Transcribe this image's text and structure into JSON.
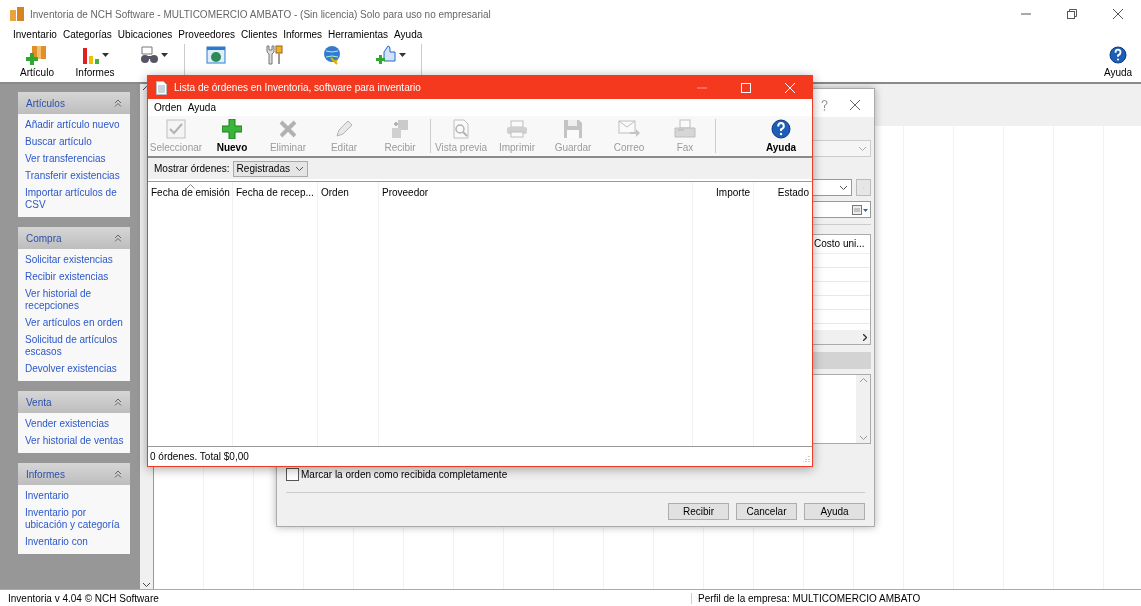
{
  "window": {
    "title": "Inventoria de NCH Software - MULTICOMERCIO AMBATO - (Sin licencia) Solo para uso no empresarial"
  },
  "menu": [
    "Inventario",
    "Categorías",
    "Ubicaciones",
    "Proveedores",
    "Clientes",
    "Informes",
    "Herramientas",
    "Ayuda"
  ],
  "toolbar": [
    {
      "label": "Artículo",
      "dropdown": false
    },
    {
      "label": "Informes",
      "dropdown": true
    },
    {
      "dropdown": true
    },
    {
      "dropdown": false
    },
    {
      "dropdown": false
    },
    {
      "dropdown": false
    },
    {
      "dropdown": true
    }
  ],
  "toolbar_help": {
    "label": "Ayuda"
  },
  "sidebar": [
    {
      "title": "Artículos",
      "expanded": true,
      "links": [
        "Añadir artículo nuevo",
        "Buscar artículo",
        "Ver transferencias",
        "Transferir existencias",
        "Importar artículos de CSV"
      ]
    },
    {
      "title": "Compra",
      "expanded": true,
      "links": [
        "Solicitar existencias",
        "Recibir existencias",
        "Ver historial de recepciones",
        "Ver artículos en orden",
        "Solicitud de artículos escasos",
        "Devolver existencias"
      ]
    },
    {
      "title": "Venta",
      "expanded": true,
      "links": [
        "Vender existencias",
        "Ver historial de ventas"
      ]
    },
    {
      "title": "Informes",
      "expanded": true,
      "links": [
        "Inventario",
        "Inventario por ubicación y categoría",
        "Inventario con"
      ]
    }
  ],
  "receive_dialog": {
    "column_header": "Costo uni...",
    "checkbox": {
      "label": "Marcar la orden como recibida completamente",
      "checked": false
    },
    "buttons": [
      "Recibir",
      "Cancelar",
      "Ayuda"
    ]
  },
  "orders_dialog": {
    "title": "Lista de órdenes en Inventoria, software para inventario",
    "menu": [
      "Orden",
      "Ayuda"
    ],
    "toolbar": [
      {
        "label": "Seleccionar",
        "disabled": true
      },
      {
        "label": "Nuevo",
        "disabled": false
      },
      {
        "label": "Eliminar",
        "disabled": true
      },
      {
        "label": "Editar",
        "disabled": true
      },
      {
        "label": "Recibir",
        "disabled": true
      },
      {
        "label": "Vista previa",
        "disabled": true
      },
      {
        "label": "Imprimir",
        "disabled": true
      },
      {
        "label": "Guardar",
        "disabled": true
      },
      {
        "label": "Correo",
        "disabled": true
      },
      {
        "label": "Fax",
        "disabled": true
      }
    ],
    "help": {
      "label": "Ayuda"
    },
    "filter": {
      "label": "Mostrar órdenes:",
      "value": "Registradas"
    },
    "columns": [
      {
        "label": "Fecha de emisión",
        "sorted": true
      },
      {
        "label": "Fecha de recep...",
        "sorted": false
      },
      {
        "label": "Orden",
        "sorted": false
      },
      {
        "label": "Proveedor",
        "sorted": false
      },
      {
        "label": "Importe",
        "sorted": false
      },
      {
        "label": "Estado",
        "sorted": false
      }
    ],
    "status": "0 órdenes. Total $0,00"
  },
  "status_bar": {
    "version": "Inventoria v 4.04 © NCH Software",
    "profile": "Perfil de la empresa: MULTICOMERCIO AMBATO"
  }
}
